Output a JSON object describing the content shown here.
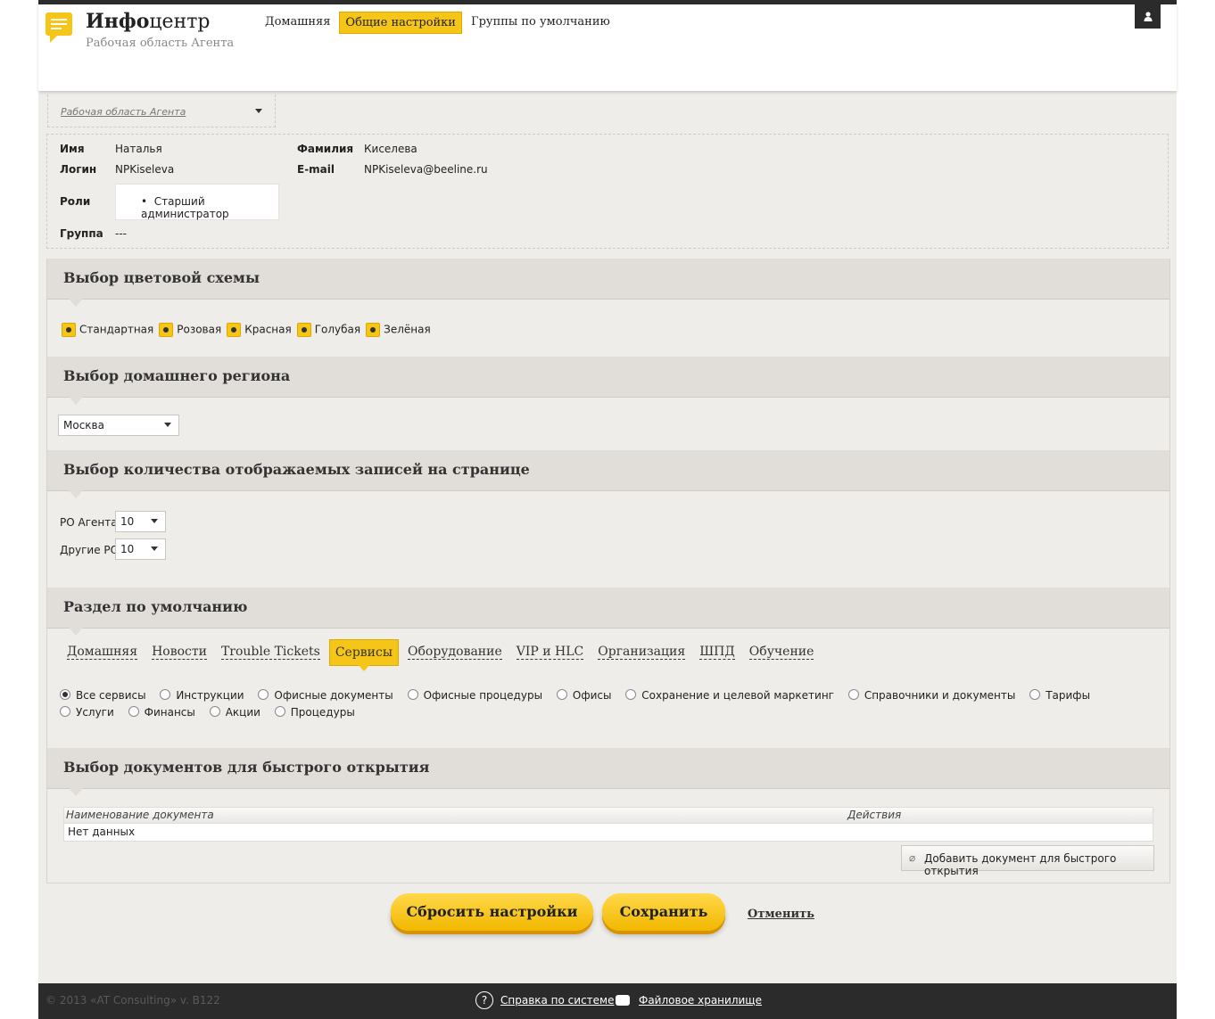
{
  "header": {
    "brand_bold": "Инфо",
    "brand_light": "центр",
    "subtitle": "Рабочая область Агента",
    "nav": [
      "Домашняя",
      "Общие настройки",
      "Группы по умолчанию"
    ],
    "active_nav": "Общие настройки"
  },
  "workspace_select": {
    "value": "Рабочая область Агента"
  },
  "user": {
    "name_label": "Имя",
    "name": "Наталья",
    "surname_label": "Фамилия",
    "surname": "Киселева",
    "login_label": "Логин",
    "login": "NPKiseleva",
    "email_label": "E-mail",
    "email": "NPKiseleva@beeline.ru",
    "roles_label": "Роли",
    "role": "Старший администратор",
    "group_label": "Группа",
    "group": "---"
  },
  "color_scheme": {
    "title": "Выбор цветовой схемы",
    "options": [
      "Стандартная",
      "Розовая",
      "Красная",
      "Голубая",
      "Зелёная"
    ]
  },
  "region": {
    "title": "Выбор домашнего региона",
    "value": "Москва"
  },
  "records": {
    "title": "Выбор количества отображаемых записей на странице",
    "agent_label": "РО Агента",
    "agent_value": "10",
    "other_label": "Другие РО",
    "other_value": "10"
  },
  "default_section": {
    "title": "Раздел по умолчанию",
    "tabs": [
      "Домашняя",
      "Новости",
      "Trouble Tickets",
      "Сервисы",
      "Оборудование",
      "VIP и HLC",
      "Организация",
      "ШПД",
      "Обучение"
    ],
    "active_tab": "Сервисы",
    "services": [
      "Все сервисы",
      "Инструкции",
      "Офисные документы",
      "Офисные процедуры",
      "Офисы",
      "Сохранение и целевой маркетинг",
      "Справочники и документы",
      "Тарифы",
      "Услуги",
      "Финансы",
      "Акции",
      "Процедуры"
    ],
    "selected_service": "Все сервисы"
  },
  "quick_docs": {
    "title": "Выбор документов для быстрого открытия",
    "col_name": "Наименование документа",
    "col_actions": "Действия",
    "empty": "Нет данных",
    "add_button": "Добавить документ для быстрого открытия"
  },
  "actions": {
    "reset": "Сбросить настройки",
    "save": "Сохранить",
    "cancel": "Отменить"
  },
  "footer": {
    "copyright": "© 2013 «AT Consulting» v. B122",
    "help": "Справка по системе",
    "storage": "Файловое хранилище"
  },
  "colors": {
    "accent": "#f5c518",
    "dark": "#2b2b2b",
    "panel_bg": "#efede9",
    "panel_head": "#e1ddd8"
  }
}
